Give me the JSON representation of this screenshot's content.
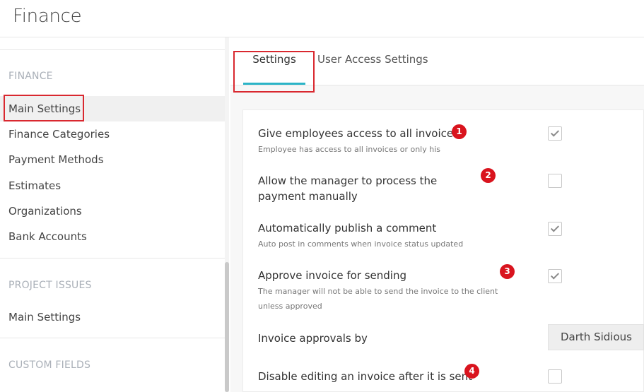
{
  "app": {
    "title": "Finance"
  },
  "sidebar": {
    "finance_section": "FINANCE",
    "finance_items": [
      {
        "label": "Main Settings",
        "active": true
      },
      {
        "label": "Finance Categories"
      },
      {
        "label": "Payment Methods"
      },
      {
        "label": "Estimates"
      },
      {
        "label": "Organizations"
      },
      {
        "label": "Bank Accounts"
      }
    ],
    "project_section": "PROJECT ISSUES",
    "project_items": [
      {
        "label": "Main Settings"
      }
    ],
    "custom_section": "CUSTOM FIELDS"
  },
  "tabs": [
    {
      "label": "Settings",
      "active": true
    },
    {
      "label": "User Access Settings"
    }
  ],
  "settings": [
    {
      "title": "Give employees access to all invoices",
      "description": "Employee has access to all invoices or only his",
      "checked": true,
      "badge": "1"
    },
    {
      "title": "Allow the manager to process the payment manually",
      "description": "",
      "checked": false,
      "badge": "2"
    },
    {
      "title": "Automatically publish a comment",
      "description": "Auto post in comments when invoice status updated",
      "checked": true
    },
    {
      "title": "Approve invoice for sending",
      "description": "The manager will not be able to send the invoice to the client unless approved",
      "checked": true,
      "badge": "3"
    },
    {
      "title": "Invoice approvals by",
      "value": "Darth Sidious"
    },
    {
      "title": "Disable editing an invoice after it is sent",
      "checked": false,
      "badge": "4"
    }
  ],
  "colors": {
    "accent": "#2bb4c7",
    "highlight_border": "#d9282f",
    "badge": "#d9141e"
  }
}
